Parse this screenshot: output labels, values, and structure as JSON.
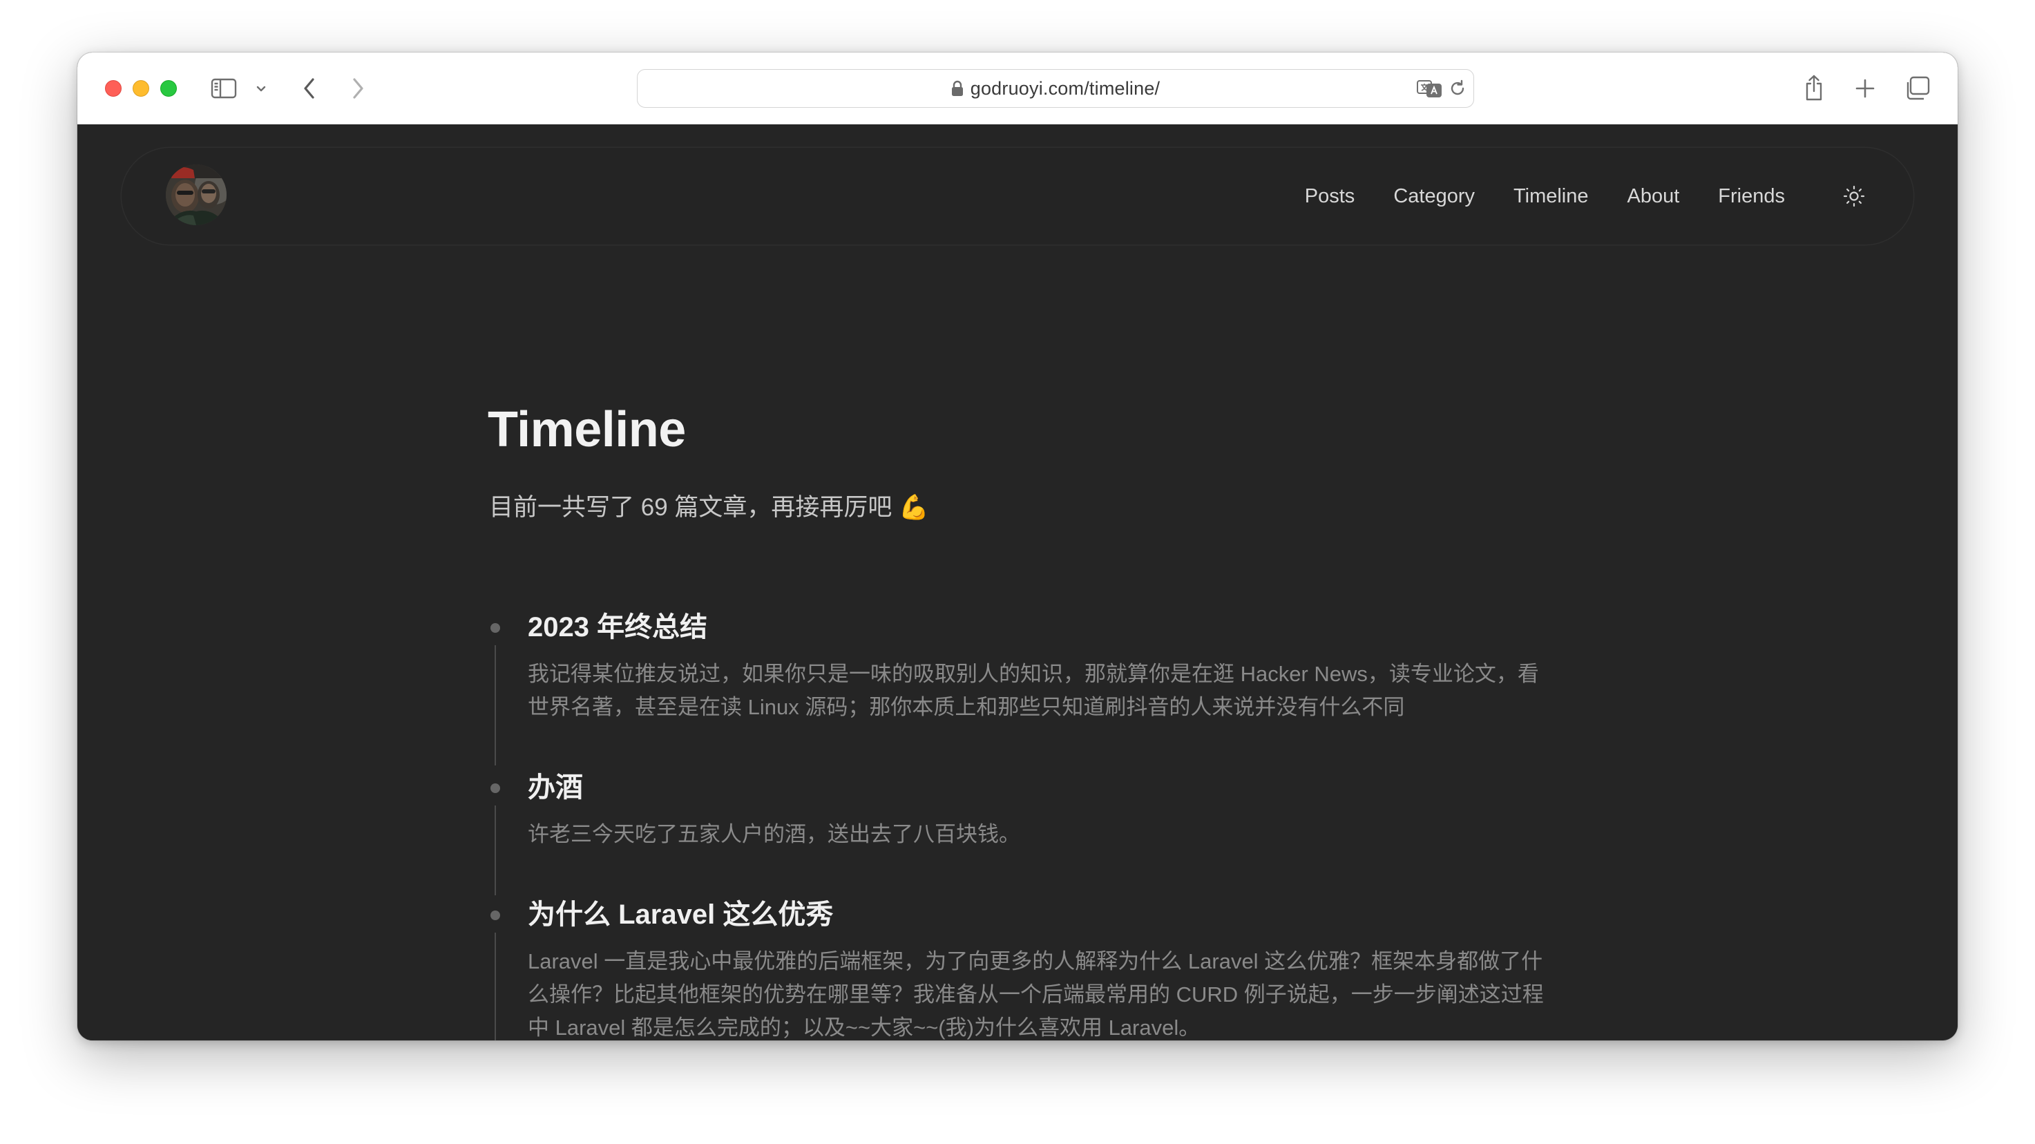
{
  "browser": {
    "url": "godruoyi.com/timeline/"
  },
  "header": {
    "nav": [
      {
        "label": "Posts"
      },
      {
        "label": "Category"
      },
      {
        "label": "Timeline"
      },
      {
        "label": "About"
      },
      {
        "label": "Friends"
      }
    ],
    "theme_icon": "sun-icon"
  },
  "main": {
    "title": "Timeline",
    "subtitle": "目前一共写了 69 篇文章，再接再厉吧",
    "subtitle_emoji": "💪",
    "posts": [
      {
        "title": "2023 年终总结",
        "excerpt": "我记得某位推友说过，如果你只是一味的吸取别人的知识，那就算你是在逛 Hacker News，读专业论文，看世界名著，甚至是在读 Linux 源码；那你本质上和那些只知道刷抖音的人来说并没有什么不同"
      },
      {
        "title": "办酒",
        "excerpt": "许老三今天吃了五家人户的酒，送出去了八百块钱。"
      },
      {
        "title": "为什么 Laravel 这么优秀",
        "excerpt": "Laravel 一直是我心中最优雅的后端框架，为了向更多的人解释为什么 Laravel 这么优雅？框架本身都做了什么操作？比起其他框架的优势在哪里等？我准备从一个后端最常用的 CURD 例子说起，一步一步阐述这过程中 Laravel 都是怎么完成的；以及~~大家~~(我)为什么喜欢用 Laravel。"
      }
    ]
  },
  "colors": {
    "page_bg": "#252525",
    "title": "#f2f2f2",
    "muted": "#8a8a8a",
    "traffic_red": "#fe5f57",
    "traffic_yellow": "#febc2e",
    "traffic_green": "#28c840"
  }
}
